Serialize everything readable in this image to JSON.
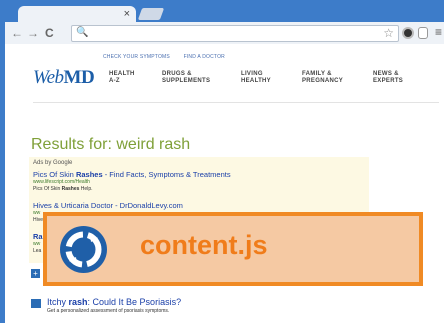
{
  "browser": {
    "tab_close": "×",
    "nav_back": "←",
    "nav_forward": "→",
    "nav_reload": "C",
    "omnibox_search_glyph": "🔍",
    "star": "☆",
    "menu": "≡"
  },
  "webmd": {
    "top_links": [
      "CHECK YOUR SYMPTOMS",
      "FIND A DOCTOR"
    ],
    "logo_web": "Web",
    "logo_md": "MD",
    "nav": [
      {
        "line1": "HEALTH",
        "line2": "A-Z"
      },
      {
        "line1": "DRUGS &",
        "line2": "SUPPLEMENTS"
      },
      {
        "line1": "LIVING",
        "line2": "HEALTHY"
      },
      {
        "line1": "FAMILY &",
        "line2": "PREGNANCY"
      },
      {
        "line1": "NEWS &",
        "line2": "EXPERTS"
      }
    ]
  },
  "results": {
    "title": "Results for: weird rash",
    "ads_label": "Ads by Google",
    "ads": [
      {
        "title_pre": "Pics Of Skin ",
        "title_bold": "Rashes",
        "title_post": " - Find Facts, Symptoms & Treatments",
        "url": "www.lifescript.com/Health",
        "desc_pre": "Pics Of Skin ",
        "desc_bold": "Rashes",
        "desc_post": " Help."
      },
      {
        "title_pre": "Hives & Urticaria Doctor - DrDonaldLevy.com",
        "title_bold": "",
        "title_post": "",
        "url": "ww",
        "desc_pre": "Hive",
        "desc_bold": "",
        "desc_post": ""
      },
      {
        "title_pre": "Ra",
        "title_bold": "",
        "title_post": "",
        "url": "ww",
        "desc_pre": "Lea",
        "desc_bold": "",
        "desc_post": ""
      }
    ],
    "second": {
      "title_pre": "Itchy ",
      "title_bold": "rash",
      "title_post": ": Could It Be Psoriasis?",
      "desc": "Get a personalized assessment of psoriasis symptoms."
    }
  },
  "overlay": {
    "label": "content.js",
    "icon": "refresh-cycle-icon"
  },
  "colors": {
    "chrome_blue": "#3d7cc9",
    "webmd_blue": "#1c5ea8",
    "results_green": "#7fa038",
    "overlay_border": "#f08a24",
    "overlay_fill": "#f5c9a3",
    "overlay_text": "#f07c1a"
  }
}
